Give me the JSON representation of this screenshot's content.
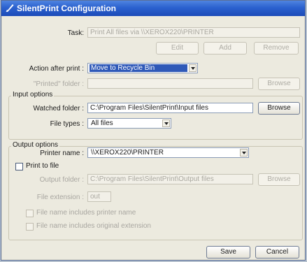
{
  "window": {
    "title": "SilentPrint Configuration",
    "icon": "quill-icon"
  },
  "task": {
    "label": "Task:",
    "value": "Print All files via \\\\XEROX220\\PRINTER",
    "buttons": {
      "edit": "Edit",
      "add": "Add",
      "remove": "Remove"
    }
  },
  "action_after_print": {
    "label": "Action after print :",
    "selected": "Move to Recycle Bin"
  },
  "printed_folder": {
    "label": "\"Printed\" folder :",
    "value": "",
    "browse": "Browse"
  },
  "input_options": {
    "title": "Input options",
    "watched_folder_label": "Watched folder :",
    "watched_folder_value": "C:\\Program Files\\SilentPrint\\Input files",
    "browse": "Browse",
    "file_types_label": "File types :",
    "file_types_selected": "All files"
  },
  "output_options": {
    "title": "Output options",
    "printer_name_label": "Printer name :",
    "printer_name_selected": "\\\\XEROX220\\PRINTER",
    "print_to_file_label": "Print to file",
    "output_folder_label": "Output folder :",
    "output_folder_value": "C:\\Program Files\\SilentPrint\\Output files",
    "browse": "Browse",
    "file_extension_label": "File extension :",
    "file_extension_value": "out",
    "includes_printer_name": "File name includes printer name",
    "includes_original_extension": "File name includes original extension"
  },
  "footer": {
    "save": "Save",
    "cancel": "Cancel"
  },
  "colors": {
    "titlebar": "#2b61cf",
    "dialog_bg": "#eceadf",
    "highlight": "#2f59b8"
  }
}
